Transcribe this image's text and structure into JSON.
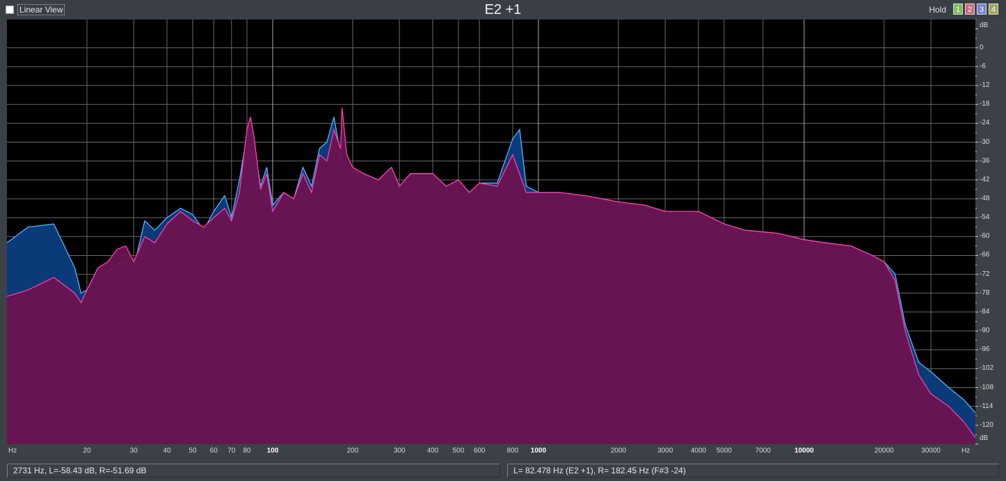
{
  "toolbar": {
    "linear_view_label": "Linear View",
    "linear_view_checked": false,
    "note_title": "E2 +1",
    "hold_label": "Hold",
    "hold_buttons": [
      {
        "label": "1",
        "color": "#7fbf5a"
      },
      {
        "label": "2",
        "color": "#cc6b7a"
      },
      {
        "label": "3",
        "color": "#7b7fd6"
      },
      {
        "label": "4",
        "color": "#9fa85a"
      }
    ]
  },
  "colors": {
    "background": "#000000",
    "grid": "#6a6a6a",
    "left_channel_fill": "#0a3a78",
    "left_channel_line": "#4fb8ff",
    "right_channel_fill": "#6a1450",
    "right_channel_line": "#ff3fae"
  },
  "db_axis": {
    "unit": "dB",
    "labels": [
      "dB",
      "0",
      "-6",
      "-12",
      "-18",
      "-24",
      "-30",
      "-36",
      "-42",
      "-48",
      "-54",
      "-60",
      "-66",
      "-72",
      "-78",
      "-84",
      "-90",
      "-96",
      "-102",
      "-108",
      "-114",
      "-120",
      "dB"
    ]
  },
  "hz_axis": {
    "unit": "Hz",
    "labels": [
      "Hz",
      "20",
      "30",
      "40",
      "50",
      "60",
      "70",
      "80",
      "100",
      "200",
      "300",
      "400",
      "500",
      "600",
      "800",
      "1000",
      "2000",
      "3000",
      "4000",
      "5000",
      "7000",
      "10000",
      "20000",
      "30000",
      "Hz"
    ],
    "major_labels": [
      "100",
      "1000",
      "10000"
    ]
  },
  "chart_data": {
    "type": "area",
    "title": "E2 +1",
    "xlabel": "Hz",
    "ylabel": "dB",
    "x_scale": "log",
    "xlim": [
      10,
      44100
    ],
    "ylim": [
      -126,
      9
    ],
    "grid": true,
    "series": [
      {
        "name": "L",
        "x": [
          10,
          12,
          15,
          18,
          19,
          20,
          22,
          24,
          26,
          28,
          30,
          33,
          36,
          40,
          45,
          50,
          55,
          60,
          66,
          70,
          75,
          80,
          82.5,
          85,
          90,
          95,
          100,
          110,
          120,
          130,
          140,
          150,
          160,
          170,
          180,
          190,
          200,
          220,
          250,
          280,
          300,
          330,
          360,
          400,
          450,
          500,
          550,
          600,
          700,
          800,
          850,
          900,
          1000,
          1200,
          1500,
          2000,
          2500,
          3000,
          4000,
          5000,
          6000,
          8000,
          10000,
          12000,
          15000,
          18000,
          20000,
          22000,
          24000,
          27000,
          30000,
          35000,
          40000,
          44100
        ],
        "values": [
          -62,
          -57,
          -56,
          -70,
          -78,
          -77,
          -70,
          -71,
          -69,
          -67,
          -70,
          -55,
          -58,
          -54,
          -51,
          -53,
          -58,
          -52,
          -47,
          -54,
          -42,
          -28,
          -22,
          -30,
          -44,
          -38,
          -50,
          -46,
          -48,
          -38,
          -44,
          -32,
          -30,
          -22,
          -34,
          -38,
          -39,
          -40,
          -42,
          -38,
          -44,
          -40,
          -40,
          -40,
          -44,
          -42,
          -46,
          -43,
          -43,
          -29,
          -26,
          -44,
          -46,
          -46,
          -47,
          -49,
          -50,
          -52,
          -52,
          -56,
          -58,
          -59,
          -61,
          -62,
          -63,
          -66,
          -68,
          -72,
          -88,
          -100,
          -103,
          -108,
          -112,
          -116
        ]
      },
      {
        "name": "R",
        "x": [
          10,
          12,
          15,
          18,
          19,
          20,
          22,
          24,
          26,
          28,
          30,
          33,
          36,
          40,
          45,
          50,
          55,
          60,
          66,
          70,
          75,
          80,
          82.5,
          85,
          90,
          95,
          100,
          110,
          120,
          130,
          140,
          150,
          160,
          170,
          180,
          182.45,
          190,
          200,
          220,
          250,
          280,
          300,
          330,
          360,
          400,
          450,
          500,
          550,
          600,
          700,
          800,
          900,
          1000,
          1200,
          1500,
          2000,
          2500,
          3000,
          4000,
          5000,
          6000,
          8000,
          10000,
          12000,
          15000,
          18000,
          20000,
          22000,
          24000,
          27000,
          30000,
          35000,
          40000,
          44100
        ],
        "values": [
          -79,
          -77,
          -73,
          -78,
          -81,
          -77,
          -70,
          -68,
          -64,
          -63,
          -68,
          -60,
          -62,
          -56,
          -52,
          -55,
          -57,
          -54,
          -51,
          -55,
          -46,
          -26,
          -22,
          -28,
          -45,
          -40,
          -52,
          -46,
          -48,
          -40,
          -46,
          -34,
          -36,
          -26,
          -32,
          -19,
          -34,
          -38,
          -40,
          -42,
          -38,
          -44,
          -40,
          -40,
          -40,
          -44,
          -42,
          -46,
          -43,
          -44,
          -34,
          -46,
          -46,
          -46,
          -47,
          -49,
          -50,
          -52,
          -52,
          -56,
          -58,
          -59,
          -61,
          -62,
          -63,
          -66,
          -68,
          -74,
          -90,
          -104,
          -110,
          -114,
          -119,
          -124
        ]
      }
    ]
  },
  "status": {
    "cursor_readout": "2731 Hz, L=-58.43 dB, R=-51.69 dB",
    "peak_readout": "L= 82.478 Hz (E2 +1), R= 182.45 Hz (F#3 -24)"
  }
}
